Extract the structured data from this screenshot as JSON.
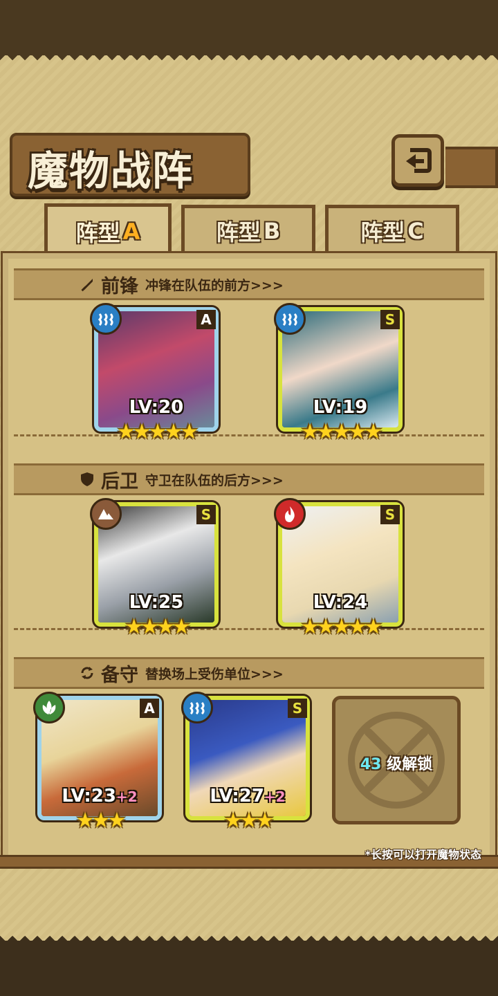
{
  "header": {
    "title": "魔物战阵"
  },
  "tabs": [
    {
      "prefix": "阵型",
      "letter": "A",
      "active": true
    },
    {
      "prefix": "阵型",
      "letter": "B",
      "active": false
    },
    {
      "prefix": "阵型",
      "letter": "C",
      "active": false
    }
  ],
  "sections": [
    {
      "label": "前锋",
      "desc": "冲锋在队伍的前方>>>",
      "icon": "sword-icon"
    },
    {
      "label": "后卫",
      "desc": "守卫在队伍的后方>>>",
      "icon": "shield-icon"
    },
    {
      "label": "备守",
      "desc": "替换场上受伤单位>>>",
      "icon": "swap-icon"
    }
  ],
  "front": [
    {
      "level": "LV:20",
      "bonus": "",
      "rank": "A",
      "element": "water",
      "stars": "★★★★★"
    },
    {
      "level": "LV:19",
      "bonus": "",
      "rank": "S",
      "element": "water",
      "stars": "★★★★★"
    }
  ],
  "back": [
    {
      "level": "LV:25",
      "bonus": "",
      "rank": "S",
      "element": "earth",
      "stars": "★★★★"
    },
    {
      "level": "LV:24",
      "bonus": "",
      "rank": "S",
      "element": "fire",
      "stars": "★★★★★"
    }
  ],
  "reserve": [
    {
      "level": "LV:23",
      "bonus": "+2",
      "rank": "A",
      "element": "wind",
      "stars": "★★★"
    },
    {
      "level": "LV:27",
      "bonus": "+2",
      "rank": "S",
      "element": "water",
      "stars": "★★★"
    }
  ],
  "locked": {
    "level_num": "43",
    "text": "级解锁"
  },
  "hint": "*长按可以打开魔物状态",
  "colors": {
    "water": "#2a7fc4",
    "earth": "#8a5a3a",
    "fire": "#d02a2a",
    "wind": "#3f8a3a",
    "star": "#ffd21e"
  }
}
